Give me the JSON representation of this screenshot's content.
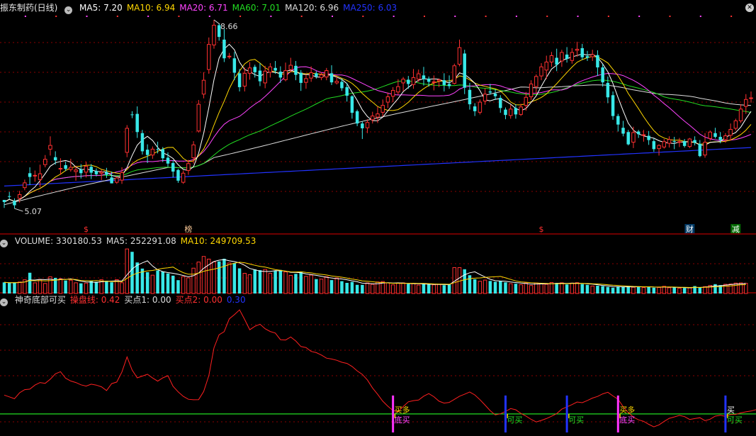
{
  "header": {
    "stock_title": "振东制药(日线)",
    "ma_labels": [
      {
        "text": "MA5: 7.20",
        "color": "#ffffff"
      },
      {
        "text": "MA10: 6.94",
        "color": "#ffd700"
      },
      {
        "text": "MA20: 6.71",
        "color": "#ff44ff"
      },
      {
        "text": "MA60: 7.01",
        "color": "#22dd22"
      },
      {
        "text": "MA120: 6.96",
        "color": "#dddddd"
      },
      {
        "text": "MA250: 6.03",
        "color": "#2233ff"
      }
    ]
  },
  "volume_header": [
    {
      "text": "VOLUME: 330180.53",
      "color": "#dddddd"
    },
    {
      "text": "MA5: 252291.08",
      "color": "#dddddd"
    },
    {
      "text": "MA10: 249709.53",
      "color": "#ffd700"
    }
  ],
  "indicator_header": [
    {
      "text": "神奇底部可买",
      "color": "#dddddd"
    },
    {
      "text": "操盘线: 0.42",
      "color": "#ff3030"
    },
    {
      "text": "买点1: 0.00",
      "color": "#dddddd"
    },
    {
      "text": "买点2: 0.00",
      "color": "#ff3030"
    },
    {
      "text": "0.30",
      "color": "#2233ff"
    }
  ],
  "price_annotations": {
    "high_label": "8.66",
    "low_label": "5.07"
  },
  "event_markers": [
    {
      "text": "$",
      "idx": 16,
      "bg": "",
      "color": "#ff3030"
    },
    {
      "text": "榜",
      "idx": 36,
      "bg": "",
      "color": "#ffcc99"
    },
    {
      "text": "$",
      "idx": 105,
      "bg": "",
      "color": "#ff3030"
    },
    {
      "text": "财",
      "idx": 134,
      "bg": "#003a66",
      "color": "#ffffff"
    },
    {
      "text": "减",
      "idx": 143,
      "bg": "#006600",
      "color": "#ffffff"
    }
  ],
  "chart_data": {
    "type": "candlestick",
    "panels": [
      "price",
      "volume",
      "indicator"
    ],
    "price_range": [
      5.07,
      8.66
    ],
    "ohlc": [
      [
        5.29,
        5.25,
        5.29,
        5.14
      ],
      [
        5.36,
        5.35,
        5.44,
        5.3
      ],
      [
        5.27,
        5.19,
        5.32,
        5.13
      ],
      [
        5.32,
        5.39,
        5.46,
        5.24
      ],
      [
        5.52,
        5.61,
        5.67,
        5.47
      ],
      [
        5.79,
        5.72,
        5.9,
        5.57
      ],
      [
        5.74,
        5.75,
        5.84,
        5.63
      ],
      [
        5.67,
        5.78,
        5.95,
        5.53
      ],
      [
        5.95,
        6.05,
        6.13,
        5.9
      ],
      [
        6.24,
        6.31,
        6.48,
        6.12
      ],
      [
        6.09,
        6.03,
        6.2,
        5.95
      ],
      [
        5.88,
        5.88,
        6.07,
        5.76
      ],
      [
        5.94,
        5.87,
        6.01,
        5.83
      ],
      [
        5.86,
        5.9,
        6.06,
        5.82
      ],
      [
        5.82,
        5.85,
        5.93,
        5.65
      ],
      [
        5.86,
        5.79,
        5.96,
        5.69
      ],
      [
        5.81,
        5.92,
        6.0,
        5.71
      ],
      [
        5.91,
        5.8,
        5.96,
        5.68
      ],
      [
        5.83,
        5.77,
        5.88,
        5.73
      ],
      [
        5.79,
        5.81,
        5.86,
        5.66
      ],
      [
        5.81,
        5.76,
        5.89,
        5.7
      ],
      [
        5.71,
        5.6,
        5.82,
        5.6
      ],
      [
        5.62,
        5.7,
        5.73,
        5.59
      ],
      [
        5.66,
        5.8,
        5.9,
        5.59
      ],
      [
        6.18,
        6.63,
        6.69,
        6.09
      ],
      [
        6.89,
        6.88,
        6.95,
        6.82
      ],
      [
        6.9,
        6.56,
        7.04,
        6.45
      ],
      [
        6.54,
        6.2,
        6.6,
        6.14
      ],
      [
        6.23,
        6.13,
        6.33,
        5.98
      ],
      [
        6.13,
        6.24,
        6.29,
        6.06
      ],
      [
        6.24,
        6.23,
        6.38,
        6.16
      ],
      [
        6.24,
        6.07,
        6.28,
        6.0
      ],
      [
        6.08,
        5.97,
        6.18,
        5.91
      ],
      [
        5.98,
        5.82,
        6.03,
        5.71
      ],
      [
        5.85,
        5.65,
        5.87,
        5.61
      ],
      [
        5.62,
        5.79,
        5.84,
        5.59
      ],
      [
        5.84,
        5.97,
        6.04,
        5.76
      ],
      [
        6.08,
        6.32,
        6.39,
        5.97
      ],
      [
        6.58,
        7.08,
        7.16,
        6.55
      ],
      [
        7.27,
        7.53,
        7.68,
        7.19
      ],
      [
        7.73,
        8.2,
        8.33,
        7.65
      ],
      [
        8.19,
        8.56,
        8.66,
        8.12
      ],
      [
        8.56,
        8.34,
        8.59,
        8.27
      ],
      [
        8.29,
        7.94,
        8.49,
        7.87
      ],
      [
        7.97,
        7.98,
        8.04,
        7.93
      ],
      [
        7.94,
        7.67,
        8.06,
        7.53
      ],
      [
        7.66,
        7.4,
        7.74,
        7.32
      ],
      [
        7.42,
        7.66,
        7.77,
        7.32
      ],
      [
        7.66,
        7.76,
        7.87,
        7.54
      ],
      [
        7.78,
        7.68,
        7.82,
        7.58
      ],
      [
        7.71,
        7.51,
        7.85,
        7.42
      ],
      [
        7.48,
        7.7,
        7.8,
        7.38
      ],
      [
        7.68,
        7.78,
        7.85,
        7.58
      ],
      [
        7.76,
        7.71,
        7.89,
        7.65
      ],
      [
        7.69,
        7.58,
        7.79,
        7.48
      ],
      [
        7.54,
        7.71,
        7.86,
        7.51
      ],
      [
        7.73,
        7.81,
        7.95,
        7.68
      ],
      [
        7.8,
        7.63,
        7.89,
        7.53
      ],
      [
        7.67,
        7.48,
        7.72,
        7.33
      ],
      [
        7.49,
        7.56,
        7.64,
        7.37
      ],
      [
        7.57,
        7.67,
        7.79,
        7.5
      ],
      [
        7.66,
        7.6,
        7.7,
        7.56
      ],
      [
        7.58,
        7.63,
        7.68,
        7.53
      ],
      [
        7.59,
        7.71,
        7.76,
        7.53
      ],
      [
        7.66,
        7.49,
        7.81,
        7.44
      ],
      [
        7.48,
        7.51,
        7.6,
        7.45
      ],
      [
        7.5,
        7.38,
        7.56,
        7.33
      ],
      [
        7.4,
        7.24,
        7.48,
        7.13
      ],
      [
        7.23,
        6.92,
        7.25,
        6.81
      ],
      [
        6.95,
        6.72,
        6.98,
        6.67
      ],
      [
        6.72,
        6.63,
        6.76,
        6.43
      ],
      [
        6.64,
        6.74,
        6.8,
        6.54
      ],
      [
        6.79,
        6.86,
        6.94,
        6.72
      ],
      [
        6.84,
        6.9,
        7.04,
        6.73
      ],
      [
        6.93,
        7.06,
        7.17,
        6.85
      ],
      [
        7.12,
        7.22,
        7.3,
        7.01
      ],
      [
        7.23,
        7.34,
        7.4,
        7.12
      ],
      [
        7.31,
        7.41,
        7.55,
        7.26
      ],
      [
        7.48,
        7.55,
        7.59,
        7.32
      ],
      [
        7.54,
        7.46,
        7.61,
        7.37
      ],
      [
        7.45,
        7.58,
        7.74,
        7.37
      ],
      [
        7.55,
        7.65,
        7.73,
        7.5
      ],
      [
        7.62,
        7.55,
        7.78,
        7.43
      ],
      [
        7.56,
        7.5,
        7.6,
        7.41
      ],
      [
        7.5,
        7.5,
        7.62,
        7.34
      ],
      [
        7.52,
        7.54,
        7.56,
        7.4
      ],
      [
        7.53,
        7.44,
        7.66,
        7.32
      ],
      [
        7.46,
        7.42,
        7.62,
        7.37
      ],
      [
        7.47,
        7.8,
        7.84,
        7.45
      ],
      [
        7.83,
        8.14,
        8.29,
        7.79
      ],
      [
        8.03,
        7.39,
        8.1,
        7.27
      ],
      [
        7.35,
        7.08,
        7.48,
        6.98
      ],
      [
        7.04,
        6.95,
        7.1,
        6.86
      ],
      [
        6.93,
        7.12,
        7.17,
        6.89
      ],
      [
        7.14,
        7.27,
        7.38,
        7.07
      ],
      [
        7.32,
        7.3,
        7.46,
        7.26
      ],
      [
        7.28,
        7.23,
        7.36,
        7.16
      ],
      [
        7.2,
        7.01,
        7.25,
        6.92
      ],
      [
        6.98,
        6.88,
        7.02,
        6.8
      ],
      [
        6.87,
        6.99,
        7.07,
        6.81
      ],
      [
        7.01,
        6.89,
        7.08,
        6.81
      ],
      [
        6.89,
        7.03,
        7.09,
        6.86
      ],
      [
        7.06,
        7.21,
        7.31,
        6.96
      ],
      [
        7.22,
        7.46,
        7.53,
        7.16
      ],
      [
        7.41,
        7.6,
        7.64,
        7.27
      ],
      [
        7.61,
        7.78,
        7.85,
        7.53
      ],
      [
        7.72,
        7.87,
        7.99,
        7.55
      ],
      [
        7.87,
        7.99,
        8.06,
        7.78
      ],
      [
        7.95,
        7.82,
        8.12,
        7.7
      ],
      [
        7.89,
        8.05,
        8.1,
        7.78
      ],
      [
        8.01,
        7.93,
        8.15,
        7.86
      ],
      [
        7.9,
        8.05,
        8.13,
        7.84
      ],
      [
        8.09,
        8.11,
        8.25,
        7.97
      ],
      [
        8.13,
        7.96,
        8.21,
        7.91
      ],
      [
        7.98,
        7.95,
        8.08,
        7.89
      ],
      [
        7.97,
        8.01,
        8.1,
        7.89
      ],
      [
        8.0,
        7.77,
        8.09,
        7.61
      ],
      [
        7.77,
        7.49,
        7.83,
        7.41
      ],
      [
        7.48,
        7.21,
        7.6,
        7.1
      ],
      [
        7.25,
        6.86,
        7.32,
        6.79
      ],
      [
        6.86,
        6.7,
        6.9,
        6.57
      ],
      [
        6.64,
        6.53,
        6.77,
        6.48
      ],
      [
        6.56,
        6.33,
        6.6,
        6.31
      ],
      [
        6.37,
        6.55,
        6.66,
        6.26
      ],
      [
        6.57,
        6.52,
        6.6,
        6.45
      ],
      [
        6.51,
        6.51,
        6.6,
        6.38
      ],
      [
        6.49,
        6.41,
        6.58,
        6.32
      ],
      [
        6.39,
        6.24,
        6.44,
        6.19
      ],
      [
        6.25,
        6.31,
        6.33,
        6.12
      ],
      [
        6.28,
        6.38,
        6.43,
        6.25
      ],
      [
        6.35,
        6.42,
        6.48,
        6.27
      ],
      [
        6.39,
        6.38,
        6.47,
        6.24
      ],
      [
        6.37,
        6.38,
        6.45,
        6.28
      ],
      [
        6.39,
        6.3,
        6.43,
        6.27
      ],
      [
        6.29,
        6.43,
        6.45,
        6.26
      ],
      [
        6.41,
        6.36,
        6.48,
        6.31
      ],
      [
        6.34,
        6.11,
        6.41,
        6.09
      ],
      [
        6.13,
        6.37,
        6.54,
        6.08
      ],
      [
        6.44,
        6.56,
        6.59,
        6.4
      ],
      [
        6.54,
        6.47,
        6.64,
        6.44
      ],
      [
        6.47,
        6.41,
        6.56,
        6.35
      ],
      [
        6.42,
        6.49,
        6.54,
        6.36
      ],
      [
        6.5,
        6.61,
        6.72,
        6.4
      ],
      [
        6.63,
        6.77,
        6.81,
        6.59
      ],
      [
        6.77,
        6.99,
        7.08,
        6.73
      ],
      [
        7.04,
        7.17,
        7.27,
        6.9
      ],
      [
        7.19,
        7.2,
        7.32,
        7.11
      ]
    ],
    "volume": [
      96063,
      90633,
      92133,
      99264,
      118346,
      179008,
      91960,
      120312,
      86815,
      143934,
      134811,
      127316,
      111937,
      114632,
      92532,
      87627,
      89632,
      106919,
      101109,
      118656,
      110210,
      96969,
      119434,
      92924,
      384269,
      359555,
      267738,
      215014,
      183718,
      158087,
      198521,
      188526,
      173008,
      153662,
      115006,
      145209,
      134837,
      218542,
      271237,
      319686,
      296651,
      272778,
      276802,
      299694,
      263314,
      262853,
      216908,
      174212,
      162012,
      207045,
      201296,
      207436,
      174306,
      194184,
      203225,
      186215,
      155968,
      169296,
      183011,
      148244,
      159128,
      124223,
      124112,
      145021,
      115622,
      134006,
      106436,
      91745,
      99808,
      74809,
      74809,
      91437,
      79130,
      99474,
      103452,
      91626,
      74808,
      89136,
      91599,
      82946,
      85262,
      72592,
      81624,
      78745,
      75328,
      78453,
      71718,
      78432,
      223113,
      223224,
      209104,
      157599,
      123117,
      105620,
      115613,
      108312,
      101312,
      108521,
      96325,
      84736,
      84226,
      75932,
      90314,
      69302,
      91137,
      85429,
      79221,
      95012,
      90616,
      92304,
      78305,
      89629,
      93511,
      81003,
      74112,
      64336,
      67001,
      63511,
      56929,
      50311,
      59101,
      56436,
      63618,
      54221,
      61120,
      51338,
      61213,
      49711,
      51821,
      62126,
      49716,
      52619,
      45721,
      47922,
      49318,
      64119,
      53619,
      59211,
      69816,
      80714,
      72318,
      79316,
      81928,
      90217,
      91829,
      87826
    ],
    "indicator": [
      21.71,
      20.19,
      18.61,
      23.72,
      26.4,
      26.81,
      30.25,
      32.43,
      31.8,
      35.28,
      39.9,
      41.74,
      36.15,
      33.75,
      32.44,
      30.49,
      29.41,
      31.04,
      30.25,
      28.79,
      25.62,
      31.55,
      32.88,
      41.43,
      54.29,
      43.12,
      36.47,
      37.95,
      39.54,
      36.33,
      33.63,
      36.44,
      38.33,
      29.3,
      24.46,
      20.64,
      18.13,
      17.72,
      17.82,
      24.8,
      38.49,
      62.14,
      73.28,
      75.92,
      86.91,
      90.52,
      94.62,
      86.38,
      77.55,
      80.5,
      82.31,
      78.41,
      76.04,
      74.71,
      69.1,
      68.8,
      71.38,
      67.93,
      63.21,
      62.39,
      59.06,
      57.98,
      55.94,
      53.29,
      52.58,
      51.44,
      49.74,
      48.77,
      46.18,
      42.43,
      39.44,
      34.55,
      27.81,
      22.41,
      16.51,
      12.2,
      8.5,
      7.52,
      11.89,
      15.95,
      16.99,
      17.47,
      20.82,
      22.99,
      20.3,
      16.52,
      14.86,
      15.5,
      18.07,
      20.74,
      22.46,
      24.37,
      21.87,
      17.81,
      13.21,
      8.46,
      4.82,
      5.75,
      7.82,
      10.23,
      9.16,
      6.08,
      3.78,
      0.99,
      -1.24,
      0.08,
      1.7,
      3.67,
      5.94,
      9.75,
      11.64,
      13.62,
      15.87,
      15.26,
      17.13,
      19.18,
      20.59,
      22.74,
      24.12,
      21.01,
      18.19,
      11.8,
      6.8,
      2.86,
      0.56,
      -0.7,
      -3.26,
      -5.41,
      -3.69,
      -0.72,
      1.85,
      3.09,
      4.38,
      3.33,
      0.89,
      1.66,
      2.42,
      -0.08,
      1.12,
      3.71,
      4.53,
      3.52,
      5.07,
      5.16,
      6.51,
      7.43,
      8.08,
      9.32,
      11.94,
      15.22
    ],
    "indicator_ref_line": 5.62,
    "signals": [
      {
        "idx": 76,
        "labels": [
          "买多",
          "底买"
        ]
      },
      {
        "idx": 98,
        "labels": [
          "可买"
        ]
      },
      {
        "idx": 110,
        "labels": [
          "可买"
        ]
      },
      {
        "idx": 120,
        "labels": [
          "买多",
          "底买"
        ]
      },
      {
        "idx": 141,
        "labels": [
          "买",
          "可买"
        ]
      }
    ]
  },
  "colors": {
    "bg": "#000000",
    "grid": "#8b0000",
    "up": "#ff3030",
    "down": "#38e8e8",
    "ma5": "#ffffff",
    "ma10": "#ffd700",
    "ma20": "#ff44ff",
    "ma60": "#22dd22",
    "ma120": "#dddddd",
    "ma250": "#2233ff",
    "indicator_line": "#ff2020",
    "ref_line": "#22dd22",
    "signal_purple": "#ff33ff",
    "signal_blue": "#2233ff"
  }
}
